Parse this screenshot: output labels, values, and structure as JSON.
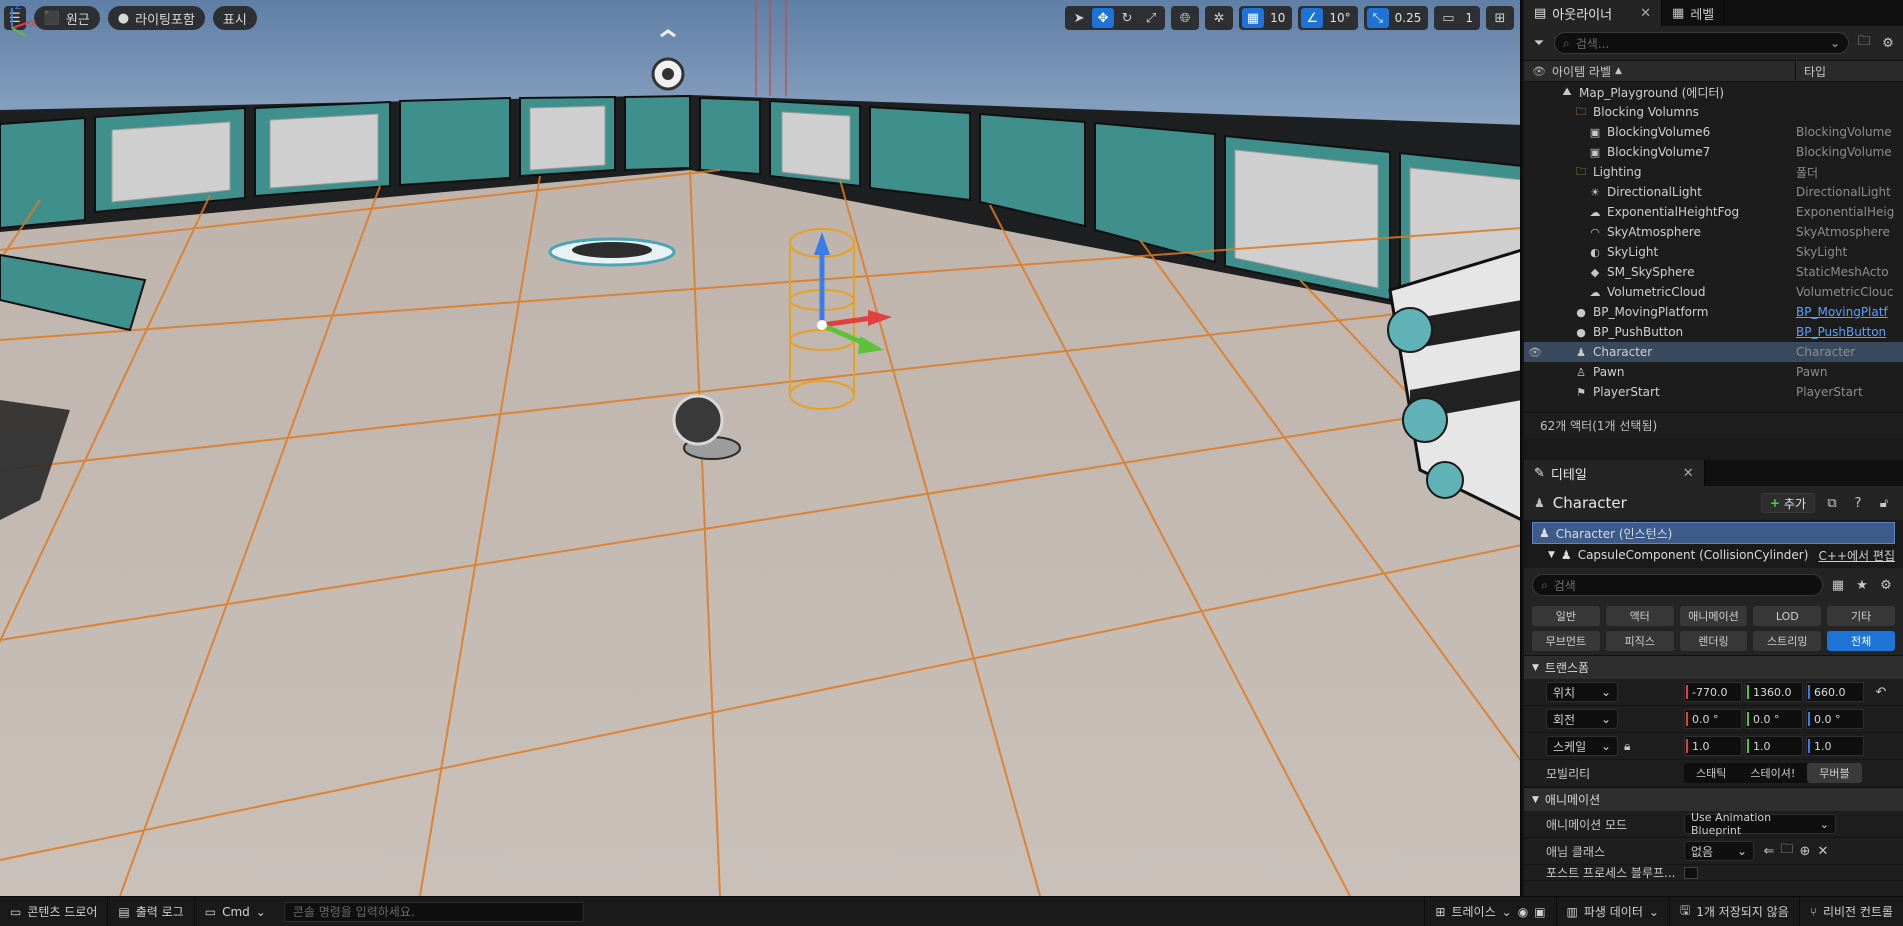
{
  "viewport": {
    "left_tools": {
      "perspective_label": "원근",
      "lighting_label": "라이팅포함",
      "show_label": "표시"
    },
    "right_tools": {
      "grid_snap_value": "10",
      "angle_snap_value": "10°",
      "scale_snap_value": "0.25",
      "camera_speed_value": "1"
    }
  },
  "outliner": {
    "tab_label": "아웃라이너",
    "levels_tab_label": "레벨",
    "search_placeholder": "검색...",
    "col_label": "아이템 라벨",
    "col_type": "타입",
    "rows": [
      {
        "name": "Map_Playground (에디터)",
        "type": "",
        "indent": 1,
        "icon": "map-icon",
        "sel": false,
        "eye": false,
        "link": false
      },
      {
        "name": "Blocking Volumns",
        "type": "",
        "indent": 2,
        "icon": "folder-icon",
        "sel": false,
        "eye": false,
        "link": false
      },
      {
        "name": "BlockingVolume6",
        "type": "BlockingVolume",
        "indent": 3,
        "icon": "volume-icon",
        "sel": false,
        "eye": false,
        "link": false
      },
      {
        "name": "BlockingVolume7",
        "type": "BlockingVolume",
        "indent": 3,
        "icon": "volume-icon",
        "sel": false,
        "eye": false,
        "link": false
      },
      {
        "name": "Lighting",
        "type": "폴더",
        "indent": 2,
        "icon": "folder-icon",
        "sel": false,
        "eye": false,
        "link": false
      },
      {
        "name": "DirectionalLight",
        "type": "DirectionalLight",
        "indent": 3,
        "icon": "light-icon",
        "sel": false,
        "eye": false,
        "link": false
      },
      {
        "name": "ExponentialHeightFog",
        "type": "ExponentialHeig",
        "indent": 3,
        "icon": "fog-icon",
        "sel": false,
        "eye": false,
        "link": false
      },
      {
        "name": "SkyAtmosphere",
        "type": "SkyAtmosphere",
        "indent": 3,
        "icon": "sky-icon",
        "sel": false,
        "eye": false,
        "link": false
      },
      {
        "name": "SkyLight",
        "type": "SkyLight",
        "indent": 3,
        "icon": "skylight-icon",
        "sel": false,
        "eye": false,
        "link": false
      },
      {
        "name": "SM_SkySphere",
        "type": "StaticMeshActo",
        "indent": 3,
        "icon": "mesh-icon",
        "sel": false,
        "eye": false,
        "link": false
      },
      {
        "name": "VolumetricCloud",
        "type": "VolumetricClouc",
        "indent": 3,
        "icon": "cloud-icon",
        "sel": false,
        "eye": false,
        "link": false
      },
      {
        "name": "BP_MovingPlatform",
        "type": "BP_MovingPlatf",
        "indent": 2,
        "icon": "actor-icon",
        "sel": false,
        "eye": false,
        "link": true
      },
      {
        "name": "BP_PushButton",
        "type": "BP_PushButton",
        "indent": 2,
        "icon": "actor-icon",
        "sel": false,
        "eye": false,
        "link": true
      },
      {
        "name": "Character",
        "type": "Character",
        "indent": 2,
        "icon": "character-icon",
        "sel": true,
        "eye": true,
        "link": false
      },
      {
        "name": "Pawn",
        "type": "Pawn",
        "indent": 2,
        "icon": "pawn-icon",
        "sel": false,
        "eye": false,
        "link": false
      },
      {
        "name": "PlayerStart",
        "type": "PlayerStart",
        "indent": 2,
        "icon": "playerstart-icon",
        "sel": false,
        "eye": false,
        "link": false
      }
    ],
    "footer": "62개 액터(1개 선택됨)"
  },
  "details": {
    "tab_label": "디테일",
    "title": "Character",
    "add_label": "추가",
    "components": {
      "root": "Character (인스턴스)",
      "child": "CapsuleComponent (CollisionCylinder)",
      "child_link": "C++에서 편집"
    },
    "search_placeholder": "검색",
    "categories": [
      "일반",
      "액터",
      "애니메이션",
      "LOD",
      "기타",
      "무브먼트",
      "피직스",
      "렌더링",
      "스트리밍",
      "전체"
    ],
    "active_category": "전체",
    "transform": {
      "section": "트랜스폼",
      "location_label": "위치",
      "location": [
        "-770.0",
        "1360.0",
        "660.0"
      ],
      "rotation_label": "회전",
      "rotation": [
        "0.0 °",
        "0.0 °",
        "0.0 °"
      ],
      "scale_label": "스케일",
      "scale": [
        "1.0",
        "1.0",
        "1.0"
      ],
      "mobility_label": "모빌리티",
      "mobility_options": [
        "스태틱",
        "스테이셔!",
        "무버블"
      ],
      "mobility_selected": "무버블"
    },
    "animation": {
      "section": "애니메이션",
      "mode_label": "애니메이션 모드",
      "mode_value": "Use Animation Blueprint",
      "class_label": "애님 클래스",
      "class_value": "없음",
      "post_label": "포스트 프로세스 블루프..."
    }
  },
  "statusbar": {
    "content_drawer": "콘텐츠 드로어",
    "output_log": "출력 로그",
    "cmd_label": "Cmd",
    "console_placeholder": "콘솔 명령을 입력하세요.",
    "trace": "트레이스",
    "derived_data": "파생 데이터",
    "unsaved": "1개 저장되지 않음",
    "revision": "리비전 컨트롤"
  },
  "colors": {
    "accent": "#1e73d6",
    "selection": "#3a4a5e",
    "grid_line": "#e07a1f",
    "x_axis": "#e04040",
    "y_axis": "#5cc23a",
    "z_axis": "#3a7de8"
  }
}
